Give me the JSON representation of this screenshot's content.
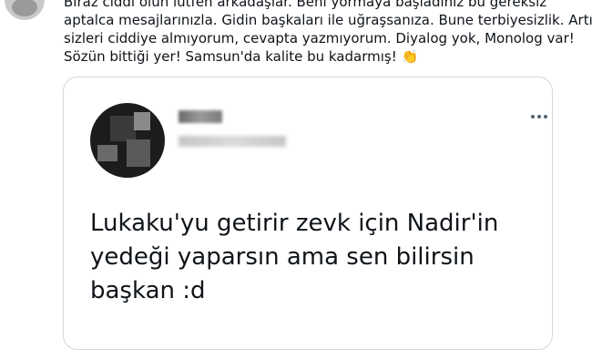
{
  "tweet": {
    "text_lines": [
      "Biraz ciddi olun lütfen arkadaşlar. Beni yormaya başladınız bu gereksiz",
      "aptalca mesajlarınızla. Gidin başkaları ile uğraşsanıza. Bune terbiyesizlik. Artık",
      "sizleri ciddiye almıyorum, cevapta yazmıyorum. Diyalog yok, Monolog var!",
      "Sözün bittiği yer! Samsun'da kalite bu kadarmış!"
    ],
    "emoji": "👏",
    "emoji_name": "clapping-hands"
  },
  "quoted_tweet": {
    "icon": "more-icon",
    "text_lines": [
      "Lukaku'yu getirir zevk için Nadir'in",
      "yedeği yaparsın ama sen bilirsin",
      "başkan :d"
    ]
  },
  "colors": {
    "text": "#0f1419",
    "border": "#cfd9de",
    "icon": "#536471"
  }
}
